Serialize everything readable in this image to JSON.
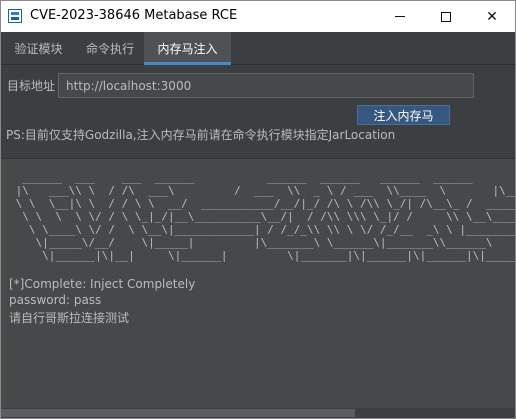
{
  "window": {
    "title": "CVE-2023-38646 Metabase RCE",
    "minimize_glyph": "",
    "close_glyph": "✕"
  },
  "tabs": [
    {
      "label": "验证模块",
      "active": false
    },
    {
      "label": "命令执行",
      "active": false
    },
    {
      "label": "内存马注入",
      "active": true
    }
  ],
  "form": {
    "target_label": "目标地址",
    "target_value": "http://localhost:3000",
    "inject_button": "注入内存马",
    "note": "PS:目前仅支持Godzilla,注入内存马前请在命令执行模块指定JarLocation"
  },
  "output": {
    "banner": "  ______  ___    ___  ______           ______  ______   ______  ______       ______\n |\\   ___\\\\ \\  / /\\  ___\\         /  ___  \\\\  _ \\ / ___  \\\\____  \\       |\\___  \\\\   __\\\n \\ \\  \\__|\\ \\  / / \\ \\  __/  ___________/__/|_/ /\\ \\ /\\\\ \\_/| /\\__\\_ /  ________\\\\ \\___\n  \\ \\  \\  \\ \\/ / \\ \\_|_/|__\\__________\\__/|  / /\\\\ \\\\\\ \\_|/ /     \\\\ \\__\\__________\\\\  \\\n   \\ \\____\\ \\/ /  \\ \\__\\|____________| / /_/_\\\\ \\\\ \\ \\/ /_/__  _\\ \\ |_________|  \\ \\\n    \\|_____\\/__/    \\|_____|         |\\_______\\ \\______\\|_______\\\\______\\        |\\___\n     \\|______|\\|__|     \\|______|         \\|_______|\\|______|\\|______|\\|______|        \\|___",
    "lines": [
      "[*]Complete: Inject Completely",
      "password: pass",
      "请自行哥斯拉连接测试"
    ]
  },
  "colors": {
    "background": "#3c3f41",
    "panel": "#45494a",
    "accent": "#4a88c7",
    "button": "#365880",
    "text": "#bbbbbb"
  },
  "icons": [
    "app-icon",
    "minimize-icon",
    "maximize-icon",
    "close-icon"
  ]
}
